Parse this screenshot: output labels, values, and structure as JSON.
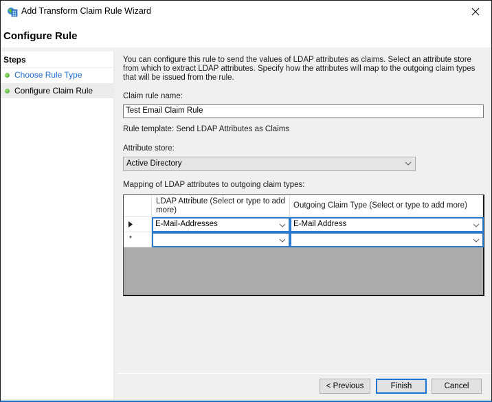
{
  "window": {
    "title": "Add Transform Claim Rule Wizard",
    "close_icon": "close-icon"
  },
  "header": {
    "title": "Configure Rule"
  },
  "steps": {
    "heading": "Steps",
    "items": [
      {
        "label": "Choose Rule Type",
        "state": "link"
      },
      {
        "label": "Configure Claim Rule",
        "state": "current"
      }
    ]
  },
  "content": {
    "description": "You can configure this rule to send the values of LDAP attributes as claims. Select an attribute store from which to extract LDAP attributes. Specify how the attributes will map to the outgoing claim types that will be issued from the rule.",
    "claim_rule_name_label": "Claim rule name:",
    "claim_rule_name_value": "Test Email Claim Rule",
    "rule_template": "Rule template: Send LDAP Attributes as Claims",
    "attribute_store_label": "Attribute store:",
    "attribute_store_value": "Active Directory",
    "mapping_label": "Mapping of LDAP attributes to outgoing claim types:",
    "mapping": {
      "columns": [
        "LDAP Attribute (Select or type to add more)",
        "Outgoing Claim Type (Select or type to add more)"
      ],
      "rows": [
        {
          "marker": "▶",
          "ldap_attribute": "E-Mail-Addresses",
          "claim_type": "E-Mail Address"
        },
        {
          "marker": "*",
          "ldap_attribute": "",
          "claim_type": ""
        }
      ]
    }
  },
  "buttons": {
    "previous": "< Previous",
    "finish": "Finish",
    "cancel": "Cancel"
  },
  "colors": {
    "link": "#1e6ccd",
    "focus_border": "#2c7bd0",
    "step_dot": "#3aa520"
  }
}
